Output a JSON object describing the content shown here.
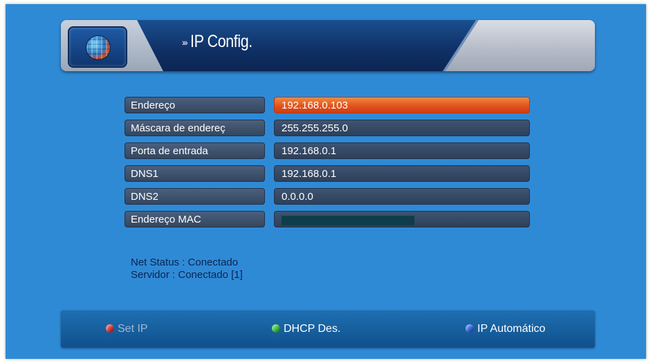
{
  "header": {
    "title": "IP Config.",
    "arrows": "›››"
  },
  "rows": [
    {
      "label": "Endereço",
      "value": "192.168.0.103",
      "active": true
    },
    {
      "label": "Máscara de endereç",
      "value": "255.255.255.0"
    },
    {
      "label": "Porta de entrada",
      "value": "192.168.0.1"
    },
    {
      "label": "DNS1",
      "value": "192.168.0.1"
    },
    {
      "label": "DNS2",
      "value": "0.0.0.0"
    },
    {
      "label": "Endereço MAC",
      "value": ""
    }
  ],
  "status": {
    "net": "Net Status : Conectado",
    "server": "Servidor : Conectado  [1]"
  },
  "footer": {
    "set_ip": {
      "label": "Set IP",
      "color": "#e53a3a",
      "text_color": "#9fb9d9"
    },
    "dhcp": {
      "label": "DHCP Des.",
      "color": "#3ccf3c",
      "text_color": "#ffffff"
    },
    "auto_ip": {
      "label": "IP Automático",
      "color": "#3a6cf0",
      "text_color": "#ffffff"
    }
  },
  "icons": {
    "header": "globe-icon"
  }
}
